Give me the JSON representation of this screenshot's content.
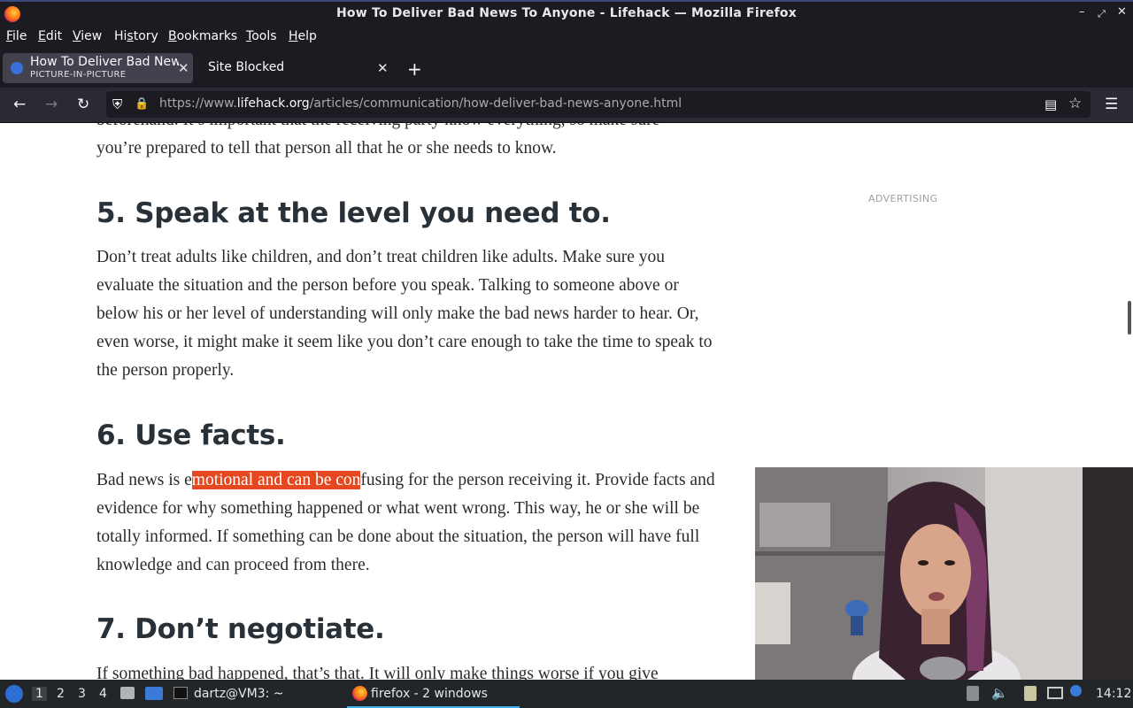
{
  "window": {
    "title": "How To Deliver Bad News To Anyone - Lifehack — Mozilla Firefox"
  },
  "menu": {
    "file": "ile",
    "file_key": "F",
    "edit": "dit",
    "edit_key": "E",
    "view": "iew",
    "view_key": "V",
    "history_a": "Hi",
    "history_key": "s",
    "history_b": "tory",
    "bookmarks": "ookmarks",
    "bookmarks_key": "B",
    "tools": "ools",
    "tools_key": "T",
    "help": "elp",
    "help_key": "H"
  },
  "tabs": [
    {
      "title": "How To Deliver Bad News To Anyone - Lifehack",
      "subtitle": "PICTURE-IN-PICTURE"
    },
    {
      "title": "Site Blocked"
    }
  ],
  "newtab_label": "+",
  "url": {
    "prefix": "https://www.",
    "domain": "lifehack.org",
    "path": "/articles/communication/how-deliver-bad-news-anyone.html"
  },
  "article": {
    "top_fragment_1": "beforehand. It’s important that the receiving party know everything, so make sure",
    "top_fragment_2": "you’re prepared to tell that person all that he or she needs to know.",
    "h5": "5. Speak at the level you need to.",
    "p5": "Don’t treat adults like children, and don’t treat children like adults. Make sure you evaluate the situation and the person before you speak. Talking to someone above or below his or her level of understanding will only make the bad news harder to hear. Or, even worse, it might make it seem like you don’t care enough to take the time to speak to the person properly.",
    "h6": "6. Use facts.",
    "p6_pre": "Bad news is e",
    "p6_highlight": "motional and can be con",
    "p6_post": "fusing for the person receiving it. Provide facts and evidence for why something happened or what went wrong. This way, he or she will be totally informed. If something can be done about the situation, the person will have full knowledge and can proceed from there.",
    "h7": "7. Don’t negotiate.",
    "p7": "If something bad happened, that’s that. It will only make things worse if you give"
  },
  "advertising_label": "ADVERTISING",
  "taskbar": {
    "workspaces": [
      "1",
      "2",
      "3",
      "4"
    ],
    "terminal_label": "dartz@VM3: ~",
    "firefox_label": "firefox - 2 windows",
    "clock": "14:12"
  },
  "colors": {
    "highlight": "#e5481f",
    "chrome_dark": "#1c1b22",
    "accent_blue": "#3a6fd8"
  }
}
